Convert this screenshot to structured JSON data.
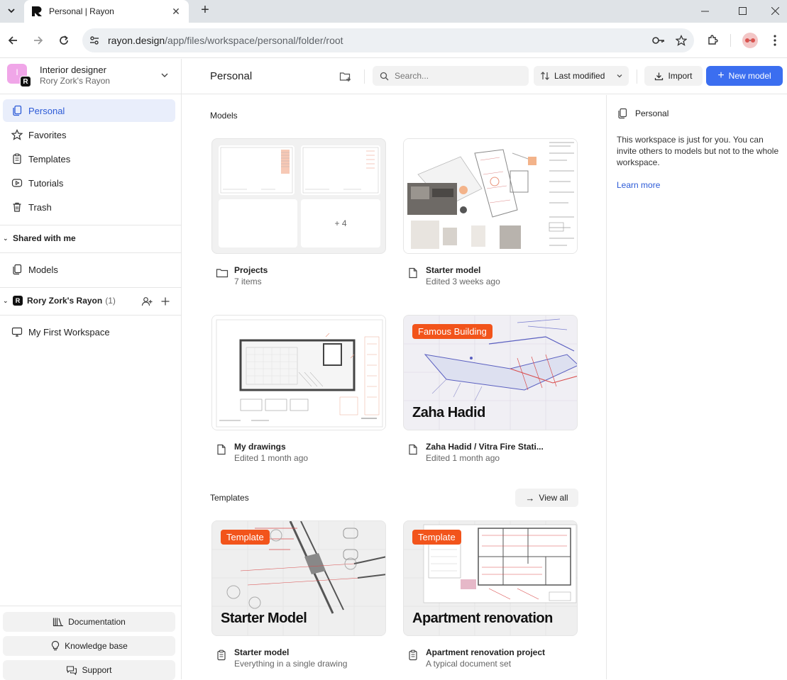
{
  "browser": {
    "tab_title": "Personal | Rayon",
    "url_host": "rayon.design",
    "url_path": "/app/files/workspace/personal/folder/root"
  },
  "workspace": {
    "avatar_letter": "I",
    "badge_letter": "R",
    "name": "Interior designer",
    "owner": "Rory Zork's Rayon"
  },
  "sidebar": {
    "items": [
      {
        "label": "Personal",
        "icon": "files-icon"
      },
      {
        "label": "Favorites",
        "icon": "star-icon"
      },
      {
        "label": "Templates",
        "icon": "clipboard-icon"
      },
      {
        "label": "Tutorials",
        "icon": "play-icon"
      },
      {
        "label": "Trash",
        "icon": "trash-icon"
      }
    ],
    "shared_header": "Shared with me",
    "shared_items": [
      {
        "label": "Models",
        "icon": "files-icon"
      }
    ],
    "team": {
      "badge": "R",
      "name": "Rory Zork's Rayon",
      "count": "(1)"
    },
    "team_items": [
      {
        "label": "My First Workspace",
        "icon": "monitor-icon"
      }
    ],
    "footer": [
      {
        "label": "Documentation",
        "icon": "books-icon"
      },
      {
        "label": "Knowledge base",
        "icon": "lightbulb-icon"
      },
      {
        "label": "Support",
        "icon": "chat-icon"
      }
    ]
  },
  "topbar": {
    "title": "Personal",
    "search_placeholder": "Search...",
    "sort_label": "Last modified",
    "import_label": "Import",
    "new_model_label": "New model"
  },
  "main": {
    "models_title": "Models",
    "cards": [
      {
        "name": "Projects",
        "meta": "7 items",
        "icon": "folder-icon",
        "more_count": "+ 4"
      },
      {
        "name": "Starter model",
        "meta": "Edited 3 weeks ago",
        "icon": "file-icon"
      },
      {
        "name": "My drawings",
        "meta": "Edited 1 month ago",
        "icon": "file-icon"
      },
      {
        "name": "Zaha Hadid / Vitra Fire Stati...",
        "meta": "Edited 1 month ago",
        "icon": "file-icon",
        "tag": "Famous Building",
        "caption": "Zaha Hadid"
      }
    ],
    "templates_title": "Templates",
    "view_all": "View all",
    "templates": [
      {
        "name": "Starter model",
        "meta": "Everything in a single drawing",
        "tag": "Template",
        "caption": "Starter Model",
        "icon": "clipboard-icon"
      },
      {
        "name": "Apartment renovation project",
        "meta": "A typical document set",
        "tag": "Template",
        "caption": "Apartment renovation",
        "icon": "clipboard-icon"
      }
    ]
  },
  "right_panel": {
    "title": "Personal",
    "description": "This workspace is just for you. You can invite others to models but not to the whole workspace.",
    "link": "Learn more"
  },
  "colors": {
    "accent": "#3b6ef0",
    "active_bg": "#e9eefb",
    "active_text": "#2d5bd7",
    "tag": "#f2541b",
    "avatar": "#f0a6e8"
  }
}
